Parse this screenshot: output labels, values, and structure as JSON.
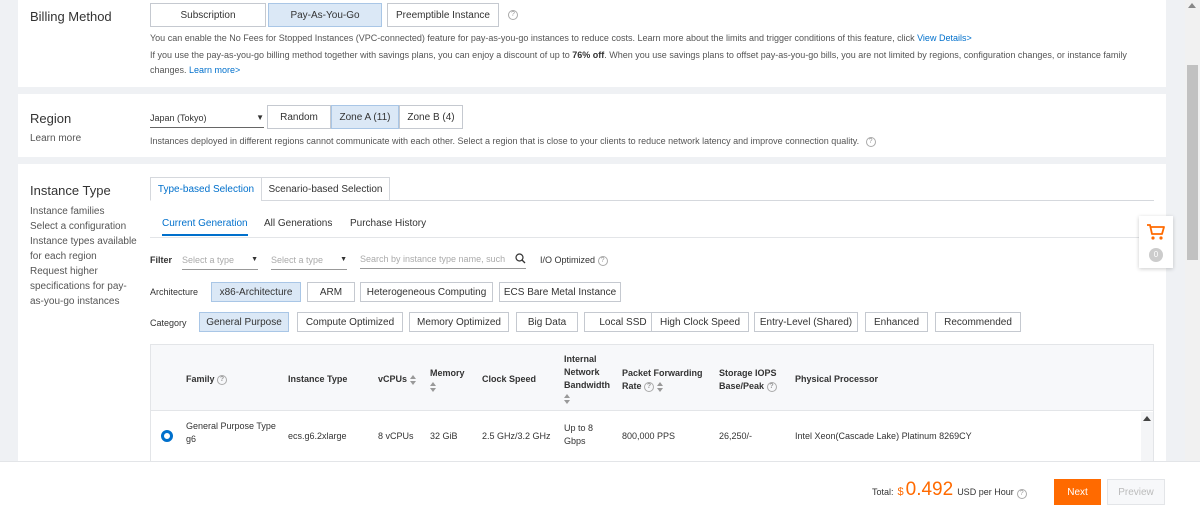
{
  "billing": {
    "title": "Billing Method",
    "options": [
      "Subscription",
      "Pay-As-You-Go",
      "Preemptible Instance"
    ],
    "desc1_pre": "You can enable the No Fees for Stopped Instances (VPC-connected) feature for pay-as-you-go instances to reduce costs. Learn more about the limits and trigger conditions of this feature, click ",
    "desc1_link": "View Details>",
    "desc2_pre": "If you use the pay-as-you-go billing method together with savings plans, you can enjoy a discount of up to ",
    "desc2_bold": "76% off",
    "desc2_post": ". When you use savings plans to offset pay-as-you-go bills, you are not limited by regions, configuration changes, or instance family changes. ",
    "desc2_link": "Learn more>"
  },
  "region": {
    "title": "Region",
    "learn_more": "Learn more",
    "selected": "Japan (Tokyo)",
    "zones": [
      "Random",
      "Zone A (11)",
      "Zone B (4)"
    ],
    "desc": "Instances deployed in different regions cannot communicate with each other. Select a region that is close to your clients to reduce network latency and improve connection quality."
  },
  "instance": {
    "title": "Instance Type",
    "side_text": "Instance families\nSelect a configuration\nInstance types available\nfor each region\nRequest higher\nspecifications for pay-\nas-you-go instances",
    "tabs": [
      "Type-based Selection",
      "Scenario-based Selection"
    ],
    "subtabs": [
      "Current Generation",
      "All Generations",
      "Purchase History"
    ],
    "filter_label": "Filter",
    "select_placeholder1": "Select a type",
    "select_placeholder2": "Select a type",
    "search_placeholder": "Search by instance type name, such as",
    "io_optimized": "I/O Optimized",
    "arch_label": "Architecture",
    "architectures": [
      "x86-Architecture",
      "ARM",
      "Heterogeneous Computing",
      "ECS Bare Metal Instance"
    ],
    "category_label": "Category",
    "categories": [
      "General Purpose",
      "Compute Optimized",
      "Memory Optimized",
      "Big Data",
      "Local SSD",
      "High Clock Speed",
      "Entry-Level (Shared)",
      "Enhanced",
      "Recommended"
    ],
    "table": {
      "headers": {
        "family": "Family",
        "type": "Instance Type",
        "vcpus": "vCPUs",
        "memory": "Memory",
        "clock": "Clock Speed",
        "bandwidth": "Internal Network Bandwidth",
        "pps": "Packet Forwarding Rate",
        "iops": "Storage IOPS Base/Peak",
        "processor": "Physical Processor"
      },
      "rows": [
        {
          "family": "General Purpose Type g6",
          "type": "ecs.g6.2xlarge",
          "vcpus": "8 vCPUs",
          "memory": "32 GiB",
          "clock": "2.5 GHz/3.2 GHz",
          "bandwidth": "Up to 8 Gbps",
          "pps": "800,000 PPS",
          "iops": "26,250/-",
          "processor": "Intel Xeon(Cascade Lake) Platinum 8269CY"
        }
      ]
    }
  },
  "cart": {
    "count": "0"
  },
  "footer": {
    "total_label": "Total:",
    "currency": "$",
    "price": "0.492",
    "unit": "USD per Hour",
    "next": "Next",
    "preview": "Preview"
  },
  "colors": {
    "accent": "#0070cc",
    "orange": "#ff6a00"
  }
}
